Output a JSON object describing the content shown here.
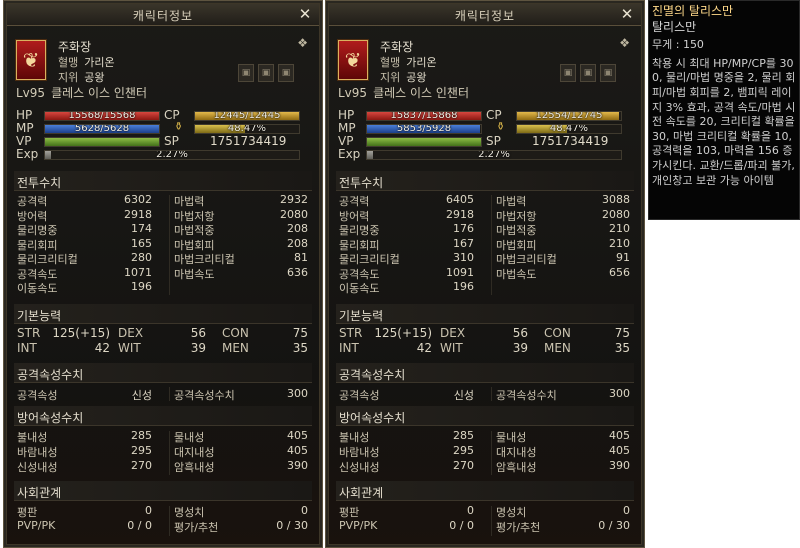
{
  "windows": [
    {
      "title": "캐릭터정보",
      "close_label": "✕",
      "name": "주화장",
      "pledge_label": "혈맹",
      "pledge_value": "가리온",
      "title_label": "지위",
      "title_value": "공왕",
      "level": "Lv95",
      "class_name": "클레스 이스 인챈터",
      "hp_label": "HP",
      "hp_text": "15568/15568",
      "hp_ratio": 1.0,
      "mp_label": "MP",
      "mp_text": "5628/5628",
      "mp_ratio": 1.0,
      "vp_label": "VP",
      "vp_ratio": 1.0,
      "cp_label": "CP",
      "cp_text": "12445/12445",
      "cp_ratio": 1.0,
      "weight_text": "48.47%",
      "weight_ratio": 0.4847,
      "sp_label": "SP",
      "sp_value": "1751734419",
      "exp_label": "Exp",
      "exp_text": "2.27%",
      "exp_ratio": 0.0227,
      "combat_head": "전투수치",
      "combat": [
        {
          "l": "공격력",
          "lv": "6302",
          "r": "마법력",
          "rv": "2932"
        },
        {
          "l": "방어력",
          "lv": "2918",
          "r": "마법저항",
          "rv": "2080"
        },
        {
          "l": "물리명중",
          "lv": "174",
          "r": "마법적중",
          "rv": "208"
        },
        {
          "l": "물리회피",
          "lv": "165",
          "r": "마법회피",
          "rv": "208"
        },
        {
          "l": "물리크리티컬",
          "lv": "280",
          "r": "마법크리티컬",
          "rv": "81"
        },
        {
          "l": "공격속도",
          "lv": "1071",
          "r": "마법속도",
          "rv": "636"
        },
        {
          "l": "이동속도",
          "lv": "196",
          "r": "",
          "rv": ""
        }
      ],
      "basic_head": "기본능력",
      "basic": [
        {
          "a": "STR",
          "av": "125(+15)",
          "b": "DEX",
          "bv": "56",
          "c": "CON",
          "cv": "75"
        },
        {
          "a": "INT",
          "av": "42",
          "b": "WIT",
          "bv": "39",
          "c": "MEN",
          "cv": "35"
        }
      ],
      "atk_attr_head": "공격속성수치",
      "atk_attr": {
        "l": "공격속성",
        "lv": "신성",
        "r": "공격속성수치",
        "rv": "300"
      },
      "def_attr_head": "방어속성수치",
      "def_attr": [
        {
          "l": "불내성",
          "lv": "285",
          "r": "물내성",
          "rv": "405"
        },
        {
          "l": "바람내성",
          "lv": "295",
          "r": "대지내성",
          "rv": "405"
        },
        {
          "l": "신성내성",
          "lv": "270",
          "r": "암흑내성",
          "rv": "390"
        }
      ],
      "social_head": "사회관계",
      "social": [
        {
          "l": "평판",
          "lv": "0",
          "r": "명성치",
          "rv": "0"
        },
        {
          "l": "PVP/PK",
          "lv": "0 / 0",
          "r": "평가/추천",
          "rv": "0 / 30"
        }
      ]
    },
    {
      "title": "캐릭터정보",
      "close_label": "✕",
      "name": "주화장",
      "pledge_label": "혈맹",
      "pledge_value": "가리온",
      "title_label": "지위",
      "title_value": "공왕",
      "level": "Lv95",
      "class_name": "클레스 이스 인챈터",
      "hp_label": "HP",
      "hp_text": "15837/15868",
      "hp_ratio": 0.998,
      "mp_label": "MP",
      "mp_text": "5853/5928",
      "mp_ratio": 0.987,
      "vp_label": "VP",
      "vp_ratio": 1.0,
      "cp_label": "CP",
      "cp_text": "12554/12745",
      "cp_ratio": 0.985,
      "weight_text": "48.47%",
      "weight_ratio": 0.4847,
      "sp_label": "SP",
      "sp_value": "1751734419",
      "exp_label": "Exp",
      "exp_text": "2.27%",
      "exp_ratio": 0.0227,
      "combat_head": "전투수치",
      "combat": [
        {
          "l": "공격력",
          "lv": "6405",
          "r": "마법력",
          "rv": "3088"
        },
        {
          "l": "방어력",
          "lv": "2918",
          "r": "마법저항",
          "rv": "2080"
        },
        {
          "l": "물리명중",
          "lv": "176",
          "r": "마법적중",
          "rv": "210"
        },
        {
          "l": "물리회피",
          "lv": "167",
          "r": "마법회피",
          "rv": "210"
        },
        {
          "l": "물리크리티컬",
          "lv": "310",
          "r": "마법크리티컬",
          "rv": "91"
        },
        {
          "l": "공격속도",
          "lv": "1091",
          "r": "마법속도",
          "rv": "656"
        },
        {
          "l": "이동속도",
          "lv": "196",
          "r": "",
          "rv": ""
        }
      ],
      "basic_head": "기본능력",
      "basic": [
        {
          "a": "STR",
          "av": "125(+15)",
          "b": "DEX",
          "bv": "56",
          "c": "CON",
          "cv": "75"
        },
        {
          "a": "INT",
          "av": "42",
          "b": "WIT",
          "bv": "39",
          "c": "MEN",
          "cv": "35"
        }
      ],
      "atk_attr_head": "공격속성수치",
      "atk_attr": {
        "l": "공격속성",
        "lv": "신성",
        "r": "공격속성수치",
        "rv": "300"
      },
      "def_attr_head": "방어속성수치",
      "def_attr": [
        {
          "l": "불내성",
          "lv": "285",
          "r": "물내성",
          "rv": "405"
        },
        {
          "l": "바람내성",
          "lv": "295",
          "r": "대지내성",
          "rv": "405"
        },
        {
          "l": "신성내성",
          "lv": "270",
          "r": "암흑내성",
          "rv": "390"
        }
      ],
      "social_head": "사회관계",
      "social": [
        {
          "l": "평판",
          "lv": "0",
          "r": "명성치",
          "rv": "0"
        },
        {
          "l": "PVP/PK",
          "lv": "0 / 0",
          "r": "평가/추천",
          "rv": "0 / 30"
        }
      ]
    }
  ],
  "tooltip": {
    "title": "진멸의 탈리스만",
    "subtitle": "탈리스만",
    "weight": "무게 : 150",
    "description": "착용 시 최대 HP/MP/CP를 300, 물리/마법 명중을 2, 물리 회피/마법 회피를 2, 뱀피릭 레이지 3% 효과, 공격 속도/마법 시전 속도를 20, 크리티컬 확률을 30, 마법 크리티컬 확률을 10, 공격력을 103, 마력을 156 증가시킨다. 교환/드롭/파괴 불가, 개인창고 보관 가능 아이템"
  },
  "icons": {
    "crest": "shield-crest-icon",
    "lock": "lock-icon",
    "gem": "gem-icon",
    "pouch": "weight-pouch-icon"
  },
  "colors": {
    "hp": "#b7281f",
    "mp": "#2e5fb8",
    "vp": "#6a9a2c",
    "cp": "#c7961f",
    "tooltip_title": "#ffd98a"
  }
}
